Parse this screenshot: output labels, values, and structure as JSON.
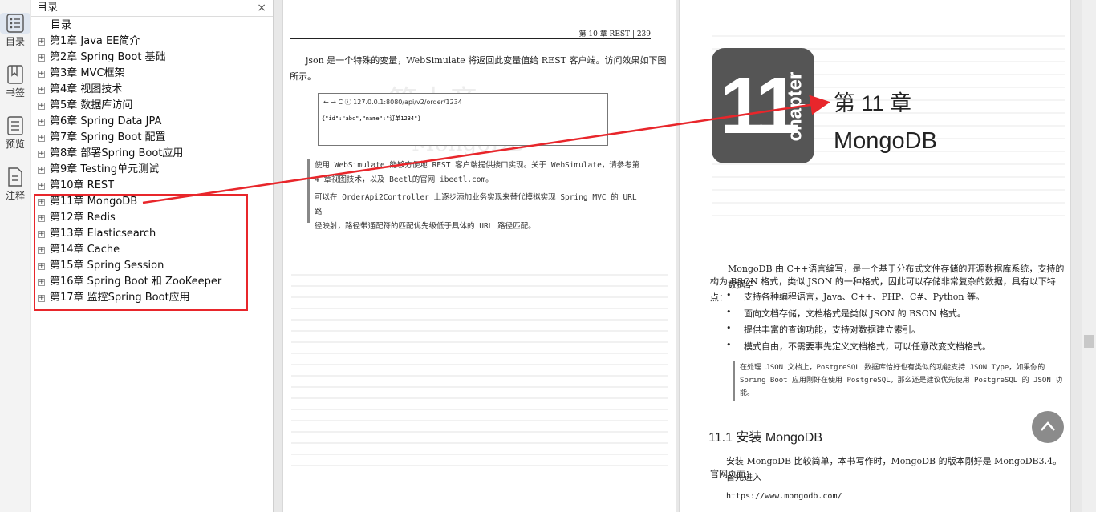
{
  "rail": [
    {
      "label": "目录",
      "icon": "list-icon"
    },
    {
      "label": "书签",
      "icon": "bookmark-icon"
    },
    {
      "label": "预览",
      "icon": "preview-icon"
    },
    {
      "label": "注释",
      "icon": "annotation-icon"
    }
  ],
  "panel": {
    "title": "目录",
    "close": "×",
    "root": "目录",
    "items": [
      "第1章 Java EE简介",
      "第2章 Spring Boot 基础",
      "第3章 MVC框架",
      "第4章 视图技术",
      "第5章 数据库访问",
      "第6章 Spring Data JPA",
      "第7章 Spring Boot 配置",
      "第8章 部署Spring Boot应用",
      "第9章 Testing单元测试",
      "第10章 REST",
      "第11章 MongoDB",
      "第12章 Redis",
      "第13章 Elasticsearch",
      "第14章 Cache",
      "第15章 Spring Session",
      "第16章 Spring Boot 和 ZooKeeper",
      "第17章 监控Spring Boot应用"
    ]
  },
  "page1": {
    "header": "第 10 章   REST   |   239",
    "para1a": "json 是一个特殊的变量，WebSimulate 将返回此变量值给 REST 客户端。访问效果如下图",
    "para1b": "所示。",
    "url": "← → C  ⓘ 127.0.0.1:8080/api/v2/order/1234",
    "json": "{\"id\":\"abc\",\"name\":\"订单1234\"}",
    "note1a": "使用 WebSimulate 能够方便地 REST 客户端提供接口实现。关于 WebSimulate，请参考第",
    "note1b": "4 章视图技术，以及 Beetl的官网 ibeetl.com。",
    "note2a": "可以在 OrderApi2Controller 上逐步添加业务实现来替代模拟实现 Spring MVC 的 URL 路",
    "note2b": "径映射，路径带通配符的匹配优先级低于具体的 URL 路径匹配。"
  },
  "page2": {
    "logo_number": "11",
    "logo_word": "chapter",
    "chapter_title": "第 11 章",
    "chapter_subtitle": "MongoDB",
    "intro_a": "MongoDB 由 C++语言编写，是一个基于分布式文件存储的开源数据库系统，支持的数据结",
    "intro_b": "构为 BSON 格式，类似 JSON 的一种格式，因此可以存储非常复杂的数据，具有以下特点：",
    "bullets": [
      "支持各种编程语言，Java、C++、PHP、C#、Python 等。",
      "面向文档存储，文档格式是类似 JSON 的 BSON 格式。",
      "提供丰富的查询功能，支持对数据建立索引。",
      "模式自由，不需要事先定义文档格式，可以任意改变文档格式。"
    ],
    "note_a": "在处理 JSON 文档上，PostgreSQL 数据库恰好也有类似的功能支持 JSON Type，如果你的",
    "note_b": "Spring Boot 应用刚好在使用 PostgreSQL，那么还是建议优先使用 PostgreSQL 的 JSON 功",
    "note_c": "能。",
    "section": "11.1   安装 MongoDB",
    "install_a": "安装 MongoDB 比较简单，本书写作时，MongoDB 的版本刚好是 MongoDB3.4。首先进入",
    "install_b": "官网页面：",
    "url": "https://www.mongodb.com/"
  },
  "colors": {
    "annotation": "#e8262b"
  }
}
